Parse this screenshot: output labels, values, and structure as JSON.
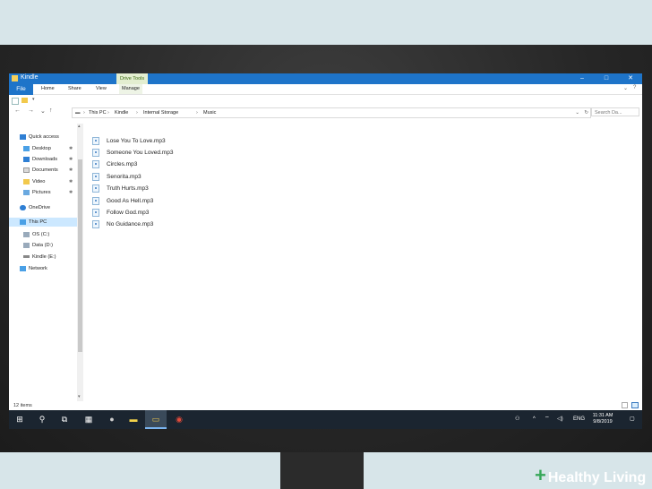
{
  "window": {
    "title": "Kindle",
    "drive_tools": "Drive Tools",
    "minimize": "–",
    "maximize": "□",
    "close": "✕"
  },
  "ribbon": {
    "tabs": [
      "File",
      "Home",
      "Share",
      "View",
      "Manage"
    ],
    "collapse": "⌄",
    "help": "?"
  },
  "address": {
    "back": "←",
    "forward": "→",
    "recent": "⌄",
    "up": "↑",
    "crumbs": [
      "This PC",
      "Kindle",
      "Internal Storage",
      "Music"
    ],
    "dropdown": "⌄",
    "refresh": "↻",
    "search_placeholder": "Search Da..."
  },
  "nav": {
    "quick_access": "Quick access",
    "desktop": "Desktop",
    "downloads": "Downloads",
    "documents": "Documents",
    "video": "Video",
    "pictures": "Pictures",
    "onedrive": "OneDrive",
    "this_pc": "This PC",
    "os_c": "OS (C:)",
    "data_d": "Data (D:)",
    "kindle_e": "Kindle  (E:)",
    "network": "Network",
    "pin": "✱"
  },
  "files": [
    "Lose You To Love.mp3",
    "Someone You Loved.mp3",
    "Circles.mp3",
    "Senorita.mp3",
    "Truth Hurts.mp3",
    "Good As Hell.mp3",
    "Follow God.mp3",
    "No Guidance.mp3"
  ],
  "status": {
    "count": "12 items"
  },
  "taskbar": {
    "start": "⊞",
    "search": "⚲",
    "taskview": "⧉",
    "calc": "▦",
    "app": "●",
    "notes": "▬",
    "explorer": "▭",
    "chrome": "◉",
    "tray_people": "⚇",
    "tray_up": "^",
    "tray_net": "⌔",
    "tray_vol": "◁)",
    "lang": "ENG",
    "time": "11:31 AM",
    "date": "9/8/2019",
    "notify": "▢"
  },
  "watermark": {
    "plus": "+",
    "text": "Healthy Living"
  }
}
